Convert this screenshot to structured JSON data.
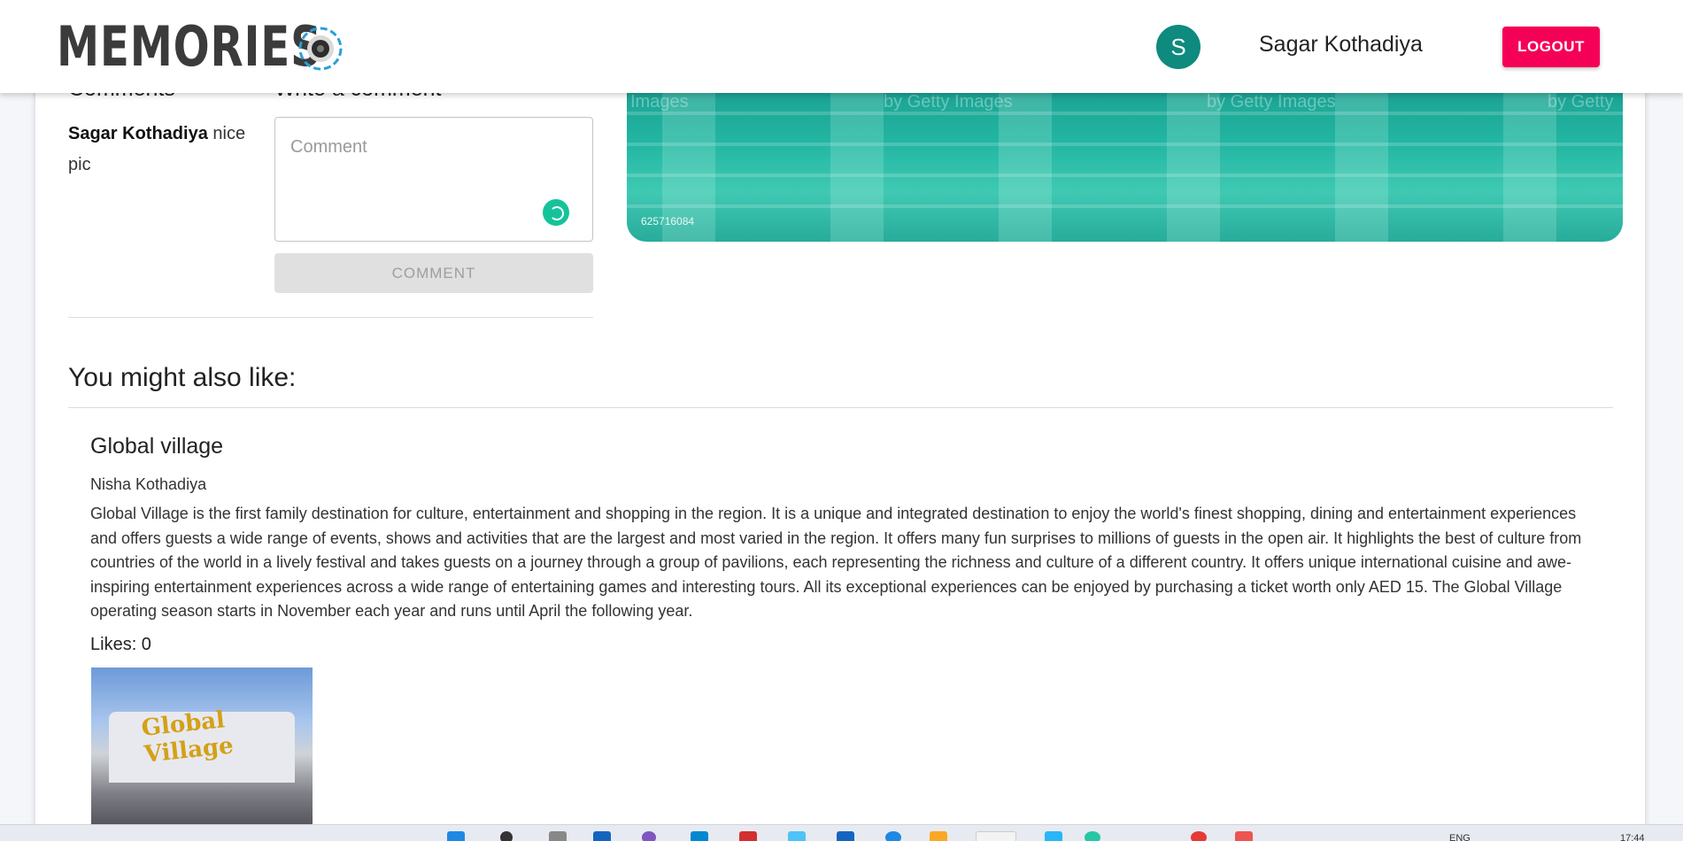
{
  "navbar": {
    "brand": "MEMORIES",
    "avatar_initial": "S",
    "user_name": "Sagar Kothadiya",
    "logout_label": "LOGOUT"
  },
  "comments": {
    "heading": "Comments",
    "write_heading": "Write a comment",
    "entries": [
      {
        "author": "Sagar Kothadiya",
        "text": " nice pic"
      }
    ],
    "placeholder": "Comment",
    "submit_label": "COMMENT"
  },
  "hero": {
    "watermarks": [
      "Images",
      "by Getty Images",
      "by Getty Images",
      "by Getty"
    ],
    "image_id": "625716084"
  },
  "suggestions": {
    "heading": "You might also like:",
    "posts": [
      {
        "title": "Global village",
        "author": "Nisha Kothadiya",
        "description": "Global Village is the first family destination for culture, entertainment and shopping in the region. It is a unique and integrated destination to enjoy the world's finest shopping, dining and entertainment experiences and offers guests a wide range of events, shows and activities that are the largest and most varied in the region. It offers many fun surprises to millions of guests in the open air. It highlights the best of culture from countries of the world in a lively festival and takes guests on a journey through a group of pavilions, each representing the richness and culture of a different country. It offers unique international cuisine and awe-inspiring entertainment experiences across a wide range of entertaining games and interesting tours. All its exceptional experiences can be enjoyed by purchasing a ticket worth only AED 15. The Global Village operating season starts in November each year and runs until April the following year.",
        "likes_label": "Likes: 0",
        "image_sign": "Global Village"
      }
    ]
  },
  "taskbar": {
    "lang": "ENG",
    "time": "17:44"
  },
  "colors": {
    "logout": "#f50057",
    "avatar": "#0e8a7e",
    "grammarly": "#15c39a"
  }
}
